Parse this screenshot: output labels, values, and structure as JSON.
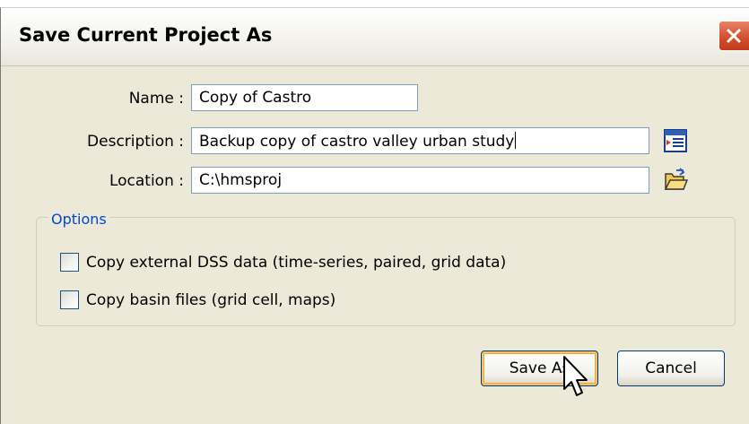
{
  "window": {
    "title": "Save Current Project As"
  },
  "form": {
    "name_label": "Name :",
    "name_value": "Copy of Castro",
    "description_label": "Description :",
    "description_value": "Backup copy of castro valley urban study",
    "location_label": "Location :",
    "location_value": "C:\\hmsproj"
  },
  "options": {
    "legend": "Options",
    "items": [
      {
        "label": "Copy external DSS data (time-series, paired, grid data)",
        "checked": false
      },
      {
        "label": "Copy basin files (grid cell, maps)",
        "checked": false
      }
    ]
  },
  "buttons": {
    "save_as": "Save As",
    "cancel": "Cancel"
  },
  "icons": {
    "close": "close-icon",
    "description_editor": "edit-description-icon",
    "browse": "open-folder-icon",
    "cursor": "mouse-pointer-icon"
  },
  "colors": {
    "window_bg": "#ece9d8",
    "close_button": "#d24d2b",
    "options_legend": "#0046d5",
    "field_border": "#7f9db9",
    "default_button_highlight": "#f5c16b"
  }
}
